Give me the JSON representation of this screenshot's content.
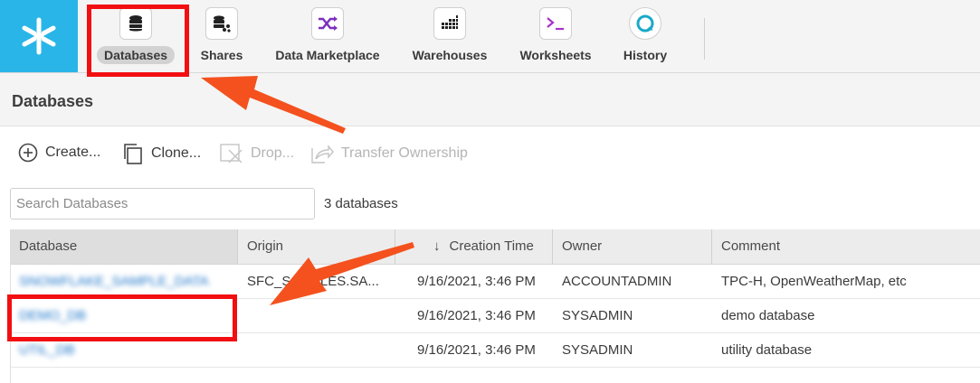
{
  "nav": {
    "items": [
      {
        "label": "Databases",
        "icon": "database-icon",
        "active": true
      },
      {
        "label": "Shares",
        "icon": "share-database-icon"
      },
      {
        "label": "Data Marketplace",
        "icon": "shuffle-icon"
      },
      {
        "label": "Warehouses",
        "icon": "warehouse-grid-icon"
      },
      {
        "label": "Worksheets",
        "icon": "terminal-icon"
      },
      {
        "label": "History",
        "icon": "history-icon"
      }
    ]
  },
  "page": {
    "title": "Databases"
  },
  "toolbar": {
    "create": "Create...",
    "clone": "Clone...",
    "drop": "Drop...",
    "transfer": "Transfer Ownership"
  },
  "search": {
    "placeholder": "Search Databases",
    "value": ""
  },
  "count_text": "3 databases",
  "table": {
    "columns": [
      "Database",
      "Origin",
      "Creation Time",
      "Owner",
      "Comment"
    ],
    "sort_indicator": "↓",
    "rows": [
      {
        "database": "SNOWFLAKE_SAMPLE_DATA",
        "origin": "SFC_SAMPLES.SA...",
        "created": "9/16/2021, 3:46 PM",
        "owner": "ACCOUNTADMIN",
        "comment": "TPC-H, OpenWeatherMap, etc"
      },
      {
        "database": "DEMO_DB",
        "origin": "",
        "created": "9/16/2021, 3:46 PM",
        "owner": "SYSADMIN",
        "comment": "demo database"
      },
      {
        "database": "UTIL_DB",
        "origin": "",
        "created": "9/16/2021, 3:46 PM",
        "owner": "SYSADMIN",
        "comment": "utility database"
      }
    ]
  },
  "colors": {
    "brand": "#29b5e8",
    "annotation": "#f20f12",
    "arrow": "#f4511e"
  }
}
